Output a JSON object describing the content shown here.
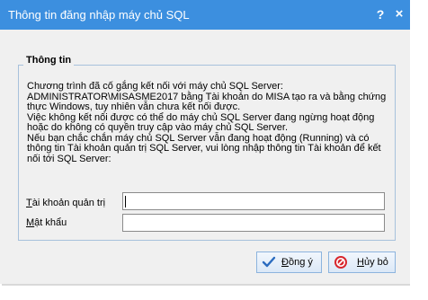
{
  "window": {
    "title": "Thông tin đăng nhập máy chủ SQL",
    "help_label": "?",
    "close_label": "×"
  },
  "group": {
    "legend": "Thông tin",
    "message_lines": [
      "Chương trình đã cố gắng kết nối với máy chủ SQL Server:",
      "ADMINISTRATOR\\MISASME2017 bằng Tài khoản do MISA tạo ra và bằng chứng thực Windows, tuy nhiên vẫn chưa kết nối được.",
      "Việc không kết nối được có thể do máy chủ SQL Server đang ngừng hoạt động hoặc do không có quyền truy cập vào máy chủ SQL Server.",
      "Nếu bạn chắc chắn máy chủ SQL Server vẫn đang hoạt động (Running) và có thông tin Tài khoản quản trị SQL Server, vui lòng nhập thông tin Tài khoản để kết nối tới SQL Server:"
    ]
  },
  "form": {
    "admin_label_first": "T",
    "admin_label_rest": "ài khoản quản trị",
    "admin_value": "",
    "password_label_first": "M",
    "password_label_rest": "ật khẩu",
    "password_value": ""
  },
  "buttons": {
    "ok_first": "Đ",
    "ok_rest": "ồng ý",
    "cancel_first": "H",
    "cancel_rest": "ủy bỏ"
  },
  "colors": {
    "titlebar": "#3c8fdf",
    "group_border": "#a7c1dc",
    "ok_icon": "#2a6bbf",
    "cancel_icon": "#d8262d"
  },
  "icons": {
    "ok": "checkmark-icon",
    "cancel": "cancel-circle-icon"
  }
}
